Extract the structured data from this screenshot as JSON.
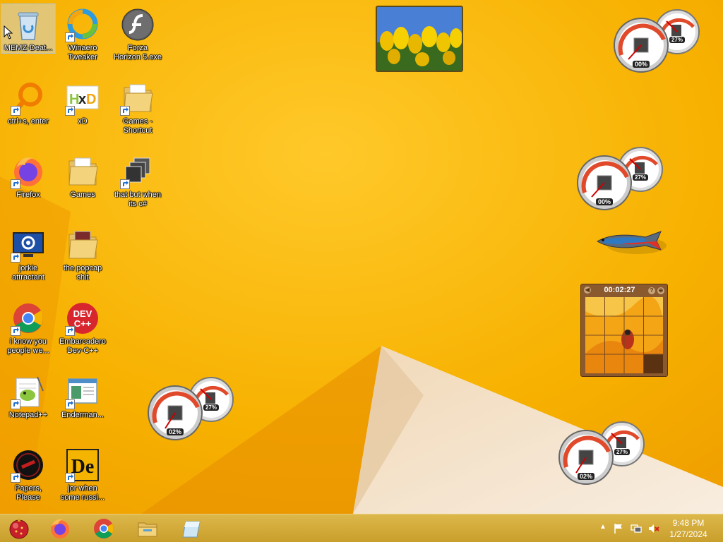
{
  "desktop": {
    "icons": [
      {
        "label": "MEMZ-Deat...",
        "icon": "recycle-bin-icon"
      },
      {
        "label": "Winaero\nTweaker",
        "icon": "winaero-icon"
      },
      {
        "label": "Forza\nHorizon 5.exe",
        "icon": "flash-icon"
      },
      {
        "label": "ctrl+s, enter",
        "icon": "magnifier-icon"
      },
      {
        "label": "xD",
        "icon": "hxd-icon"
      },
      {
        "label": "Games -\nShortcut",
        "icon": "folder-icon"
      },
      {
        "label": "Firefox",
        "icon": "firefox-icon"
      },
      {
        "label": "Games",
        "icon": "folder-icon"
      },
      {
        "label": "that but when\nits c#",
        "icon": "stack-icon"
      },
      {
        "label": "jorkie\nattractant",
        "icon": "settings-monitor-icon"
      },
      {
        "label": "the popcap\nshit",
        "icon": "folder-icon"
      },
      {
        "label": "i know you\npeople we...",
        "icon": "chrome-icon"
      },
      {
        "label": "Embarcadero\nDev-C++",
        "icon": "devcpp-icon"
      },
      {
        "label": "Notepad++",
        "icon": "notepadpp-icon"
      },
      {
        "label": "Enderman...",
        "icon": "window-icon"
      },
      {
        "label": "Papers,\nPlease",
        "icon": "papers-please-icon"
      },
      {
        "label": "jor when\nsome russi...",
        "icon": "de-icon"
      }
    ]
  },
  "gadgets": {
    "meters": [
      {
        "cpu": "00%",
        "memory": "27%"
      },
      {
        "cpu": "00%",
        "memory": "27%"
      },
      {
        "cpu": "02%",
        "memory": "27%"
      },
      {
        "cpu": "02%",
        "memory": "27%"
      }
    ],
    "puzzle": {
      "timer": "00:02:27",
      "help": "?",
      "menu": "⊕",
      "back": "◀"
    }
  },
  "taskbar": {
    "pinned": [
      "start-orb-icon",
      "firefox-icon",
      "chrome-icon",
      "file-explorer-icon",
      "blank-app-icon"
    ],
    "tray": {
      "chevron": "▲"
    },
    "clock": {
      "time": "9:48 PM",
      "date": "1/27/2024"
    }
  },
  "colors": {
    "wallpaper": "#f7b500",
    "taskbar": "#d4ae3e",
    "accent": "#e09a00"
  }
}
